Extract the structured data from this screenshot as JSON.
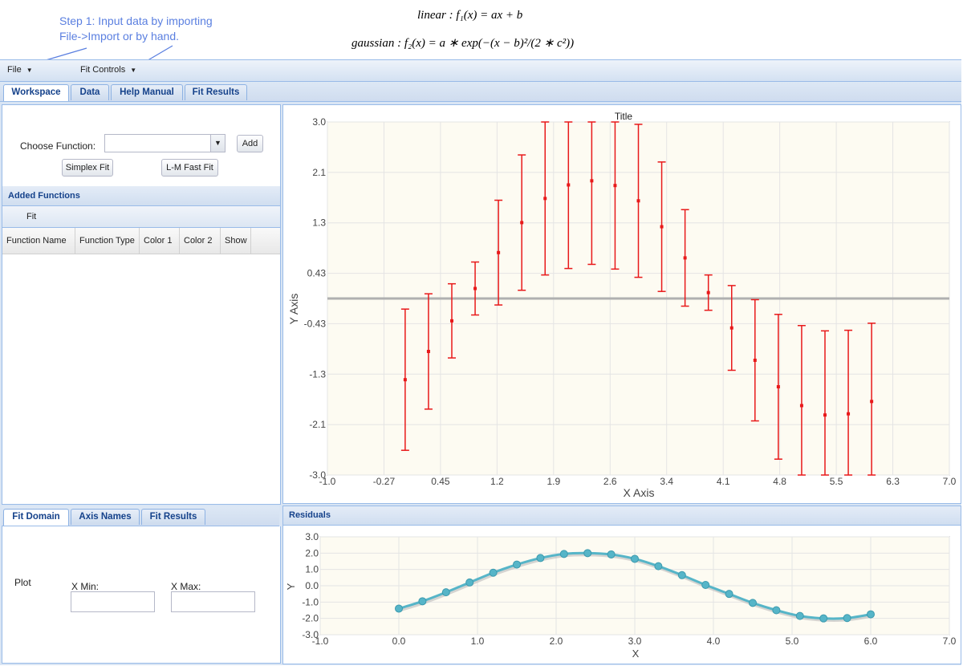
{
  "annotation": {
    "line1": "Step 1: Input data by importing",
    "line2": "File->Import or by hand."
  },
  "formulas": {
    "linear": "linear : f₁(x) = ax + b",
    "gaussian": "gaussian : f₂(x) = a ∗ exp(−(x − b)²/(2 ∗ c²))"
  },
  "menu": {
    "file": "File",
    "fit_controls": "Fit Controls"
  },
  "main_tabs": [
    "Workspace",
    "Data",
    "Help Manual",
    "Fit Results"
  ],
  "workspace": {
    "choose_function_label": "Choose Function:",
    "choose_function_value": "",
    "add_label": "Add",
    "simplex_label": "Simplex Fit",
    "lm_label": "L-M Fast Fit",
    "added_functions_title": "Added Functions",
    "fit_label": "Fit",
    "columns": [
      "Function Name",
      "Function Type",
      "Color 1",
      "Color 2",
      "Show"
    ]
  },
  "bottom_tabs": [
    "Fit Domain",
    "Axis Names",
    "Fit Results"
  ],
  "fit_domain": {
    "plot_label": "Plot",
    "xmin_label": "X Min:",
    "xmax_label": "X Max:",
    "xmin_value": "",
    "xmax_value": ""
  },
  "residuals_title": "Residuals",
  "chart_data": [
    {
      "type": "scatter",
      "title": "Title",
      "xlabel": "X Axis",
      "ylabel": "Y Axis",
      "xlim": [
        -1.0,
        7.0
      ],
      "ylim": [
        -3.0,
        3.0
      ],
      "xticks": [
        "-1.0",
        "-0.27",
        "0.45",
        "1.2",
        "1.9",
        "2.6",
        "3.4",
        "4.1",
        "4.8",
        "5.5",
        "6.3",
        "7.0"
      ],
      "yticks": [
        "3.0",
        "2.1",
        "1.3",
        "0.43",
        "-0.43",
        "-1.3",
        "-2.1",
        "-3.0"
      ],
      "grid": true,
      "color": "#e8191a",
      "horizontal_line_y": 0,
      "points": [
        {
          "x": 0.0,
          "y": -1.38,
          "err": 1.2
        },
        {
          "x": 0.3,
          "y": -0.9,
          "err": 0.98
        },
        {
          "x": 0.6,
          "y": -0.38,
          "err": 0.63
        },
        {
          "x": 0.9,
          "y": 0.17,
          "err": 0.45
        },
        {
          "x": 1.2,
          "y": 0.78,
          "err": 0.89
        },
        {
          "x": 1.5,
          "y": 1.29,
          "err": 1.15
        },
        {
          "x": 1.8,
          "y": 1.7,
          "err": 1.3
        },
        {
          "x": 2.1,
          "y": 1.93,
          "err": 1.42
        },
        {
          "x": 2.4,
          "y": 2.0,
          "err": 1.42
        },
        {
          "x": 2.7,
          "y": 1.92,
          "err": 1.42
        },
        {
          "x": 3.0,
          "y": 1.66,
          "err": 1.3
        },
        {
          "x": 3.3,
          "y": 1.22,
          "err": 1.1
        },
        {
          "x": 3.6,
          "y": 0.69,
          "err": 0.82
        },
        {
          "x": 3.9,
          "y": 0.1,
          "err": 0.3
        },
        {
          "x": 4.2,
          "y": -0.5,
          "err": 0.72
        },
        {
          "x": 4.5,
          "y": -1.05,
          "err": 1.03
        },
        {
          "x": 4.8,
          "y": -1.5,
          "err": 1.23
        },
        {
          "x": 5.1,
          "y": -1.82,
          "err": 1.36
        },
        {
          "x": 5.4,
          "y": -1.98,
          "err": 1.43
        },
        {
          "x": 5.7,
          "y": -1.96,
          "err": 1.42
        },
        {
          "x": 6.0,
          "y": -1.75,
          "err": 1.33
        }
      ]
    },
    {
      "type": "line",
      "title": "Residuals",
      "xlabel": "X",
      "ylabel": "Y",
      "xlim": [
        -1.0,
        7.0
      ],
      "ylim": [
        -3.0,
        3.0
      ],
      "xticks": [
        "-1.0",
        "0.0",
        "1.0",
        "2.0",
        "3.0",
        "4.0",
        "5.0",
        "6.0",
        "7.0"
      ],
      "yticks": [
        "3.0",
        "2.0",
        "1.0",
        "0.0",
        "-1.0",
        "-2.0",
        "-3.0"
      ],
      "grid": true,
      "color": "#56b5c8",
      "x": [
        0.0,
        0.3,
        0.6,
        0.9,
        1.2,
        1.5,
        1.8,
        2.1,
        2.4,
        2.7,
        3.0,
        3.3,
        3.6,
        3.9,
        4.2,
        4.5,
        4.8,
        5.1,
        5.4,
        5.7,
        6.0
      ],
      "y": [
        -1.4,
        -0.95,
        -0.4,
        0.2,
        0.8,
        1.3,
        1.7,
        1.95,
        2.0,
        1.92,
        1.65,
        1.2,
        0.65,
        0.05,
        -0.5,
        -1.05,
        -1.5,
        -1.85,
        -2.0,
        -1.98,
        -1.75
      ]
    }
  ]
}
